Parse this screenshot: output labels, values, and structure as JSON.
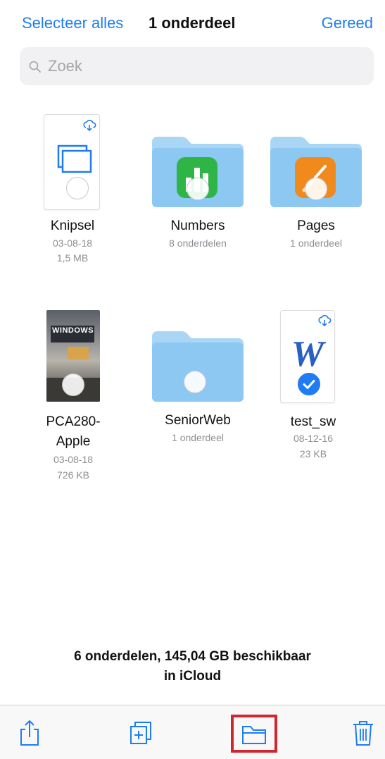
{
  "navbar": {
    "select_all_label": "Selecteer alles",
    "title": "1 onderdeel",
    "done_label": "Gereed"
  },
  "search": {
    "placeholder": "Zoek"
  },
  "items": [
    {
      "name": "Knipsel",
      "line1": "03-08-18",
      "line2": "1,5 MB",
      "type": "document",
      "icon": "screenshot-icon",
      "cloud": true
    },
    {
      "name": "Numbers",
      "line1": "8 onderdelen",
      "type": "folder",
      "icon": "numbers-app-icon"
    },
    {
      "name": "Pages",
      "line1": "1 onderdeel",
      "type": "folder",
      "icon": "pages-app-icon"
    },
    {
      "name_line1": "PCA280-",
      "name_line2": "Apple",
      "line1": "03-08-18",
      "line2": "726 KB",
      "type": "photo",
      "thumb_text": "WINDOWS"
    },
    {
      "name": "SeniorWeb",
      "line1": "1 onderdeel",
      "type": "folder"
    },
    {
      "name": "test_sw",
      "line1": "08-12-16",
      "line2": "23 KB",
      "type": "document",
      "icon": "word-icon",
      "cloud": true,
      "selected": true
    }
  ],
  "footer": {
    "line1": "6 onderdelen, 145,04 GB beschikbaar",
    "line2": "in iCloud"
  },
  "toolbar": {
    "items": [
      "share-icon",
      "duplicate-icon",
      "move-folder-icon",
      "trash-icon"
    ]
  },
  "colors": {
    "accent": "#1f7cf3",
    "folder": "#8cc8f2",
    "folder_tab": "#a9d6f5",
    "numbers_green": "#2fb547",
    "pages_orange": "#f08a1d",
    "highlight_red": "#d0262d"
  }
}
